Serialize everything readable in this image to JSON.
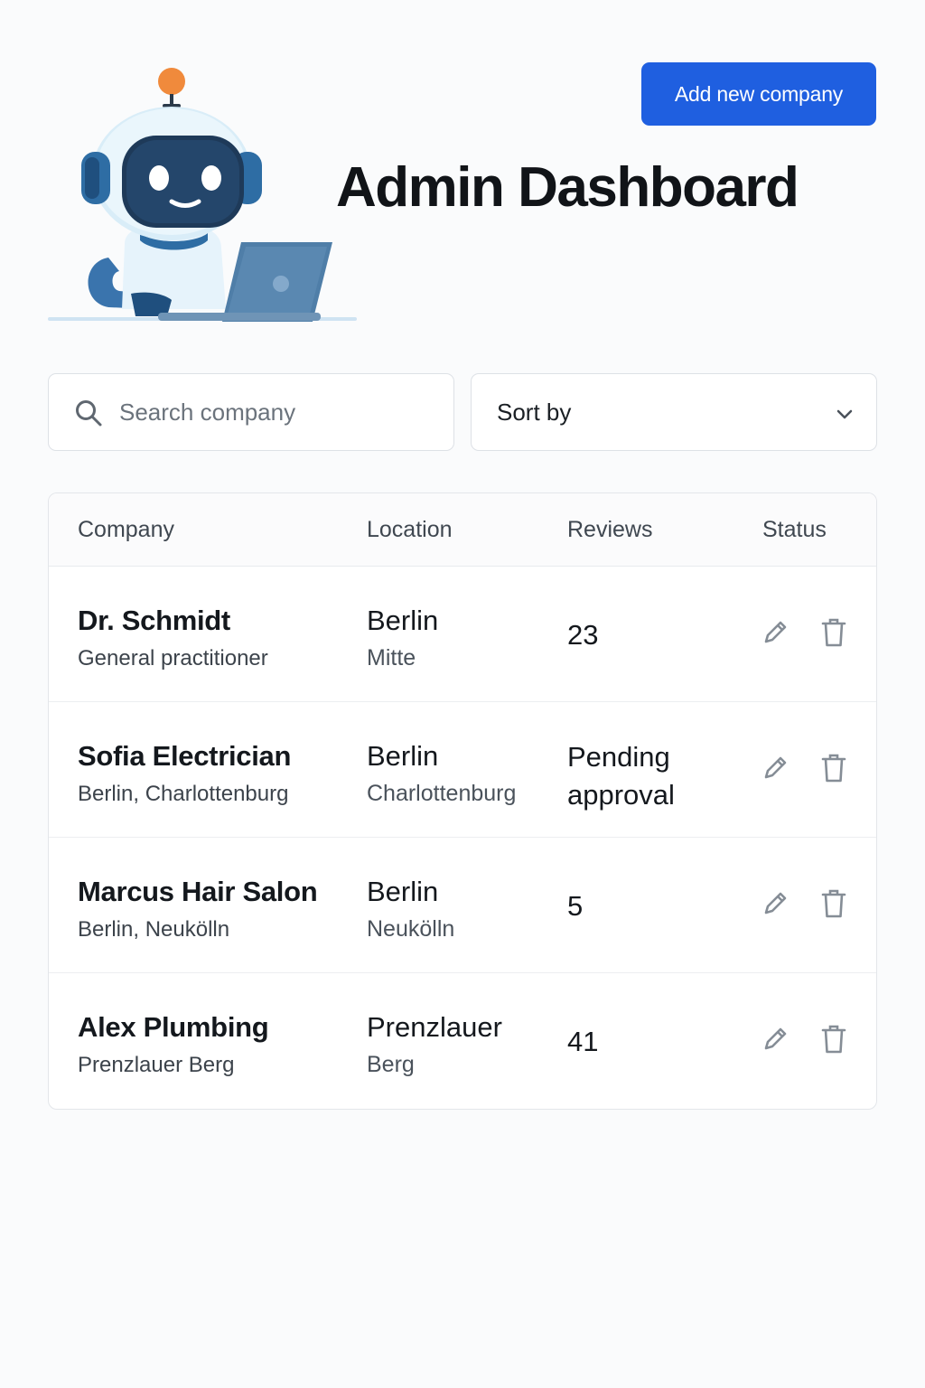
{
  "header": {
    "title": "Admin Dashboard",
    "add_button_label": "Add new company",
    "mascot_icon": "robot-with-laptop-icon"
  },
  "search": {
    "placeholder": "Search company",
    "value": "",
    "icon": "search-icon"
  },
  "sort": {
    "label": "Sort by",
    "icon": "chevron-down-icon"
  },
  "table": {
    "columns": [
      "Company",
      "Location",
      "Reviews",
      "Status"
    ],
    "rows": [
      {
        "company": "Dr. Schmidt",
        "subtitle": "General practitioner",
        "city": "Berlin",
        "district": "Mitte",
        "reviews": "23"
      },
      {
        "company": "Sofia Electrician",
        "subtitle": "Berlin, Charlottenburg",
        "city": "Berlin",
        "district": "Charlottenburg",
        "reviews": "Pending approval"
      },
      {
        "company": "Marcus Hair Salon",
        "subtitle": "Berlin, Neukölln",
        "city": "Berlin",
        "district": "Neukölln",
        "reviews": "5"
      },
      {
        "company": "Alex Plumbing",
        "subtitle": "Prenzlauer Berg",
        "city": "Prenzlauer",
        "district": "Berg",
        "reviews": "41"
      }
    ],
    "row_actions": [
      "pencil-icon",
      "trash-icon"
    ]
  },
  "colors": {
    "accent": "#1f5fe0",
    "background": "#fafbfc",
    "mascot_antenna": "#f08a3c",
    "mascot_blue": "#2e6da4"
  }
}
